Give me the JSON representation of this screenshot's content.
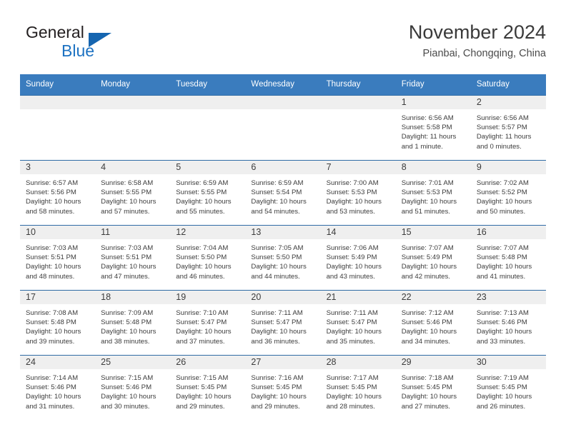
{
  "brand": {
    "name_top": "General",
    "name_bottom": "Blue",
    "triangle_color": "#1565b0",
    "blue_color": "#1d72c2"
  },
  "header": {
    "title": "November 2024",
    "subtitle": "Pianbai, Chongqing, China"
  },
  "theme": {
    "header_row_bg": "#3a7cbe",
    "daynum_band_bg": "#efefef",
    "row_border": "#2f6ba5",
    "text": "#3c3c3c"
  },
  "labels": {
    "sunrise_prefix": "Sunrise:",
    "sunset_prefix": "Sunset:",
    "daylight_prefix": "Daylight:"
  },
  "weekdays": [
    "Sunday",
    "Monday",
    "Tuesday",
    "Wednesday",
    "Thursday",
    "Friday",
    "Saturday"
  ],
  "weeks": [
    [
      {
        "day": "",
        "empty": true
      },
      {
        "day": "",
        "empty": true
      },
      {
        "day": "",
        "empty": true
      },
      {
        "day": "",
        "empty": true
      },
      {
        "day": "",
        "empty": true
      },
      {
        "day": "1",
        "sunrise": "Sunrise: 6:56 AM",
        "sunset": "Sunset: 5:58 PM",
        "daylight_line1": "Daylight: 11 hours",
        "daylight_line2": "and 1 minute."
      },
      {
        "day": "2",
        "sunrise": "Sunrise: 6:56 AM",
        "sunset": "Sunset: 5:57 PM",
        "daylight_line1": "Daylight: 11 hours",
        "daylight_line2": "and 0 minutes."
      }
    ],
    [
      {
        "day": "3",
        "sunrise": "Sunrise: 6:57 AM",
        "sunset": "Sunset: 5:56 PM",
        "daylight_line1": "Daylight: 10 hours",
        "daylight_line2": "and 58 minutes."
      },
      {
        "day": "4",
        "sunrise": "Sunrise: 6:58 AM",
        "sunset": "Sunset: 5:55 PM",
        "daylight_line1": "Daylight: 10 hours",
        "daylight_line2": "and 57 minutes."
      },
      {
        "day": "5",
        "sunrise": "Sunrise: 6:59 AM",
        "sunset": "Sunset: 5:55 PM",
        "daylight_line1": "Daylight: 10 hours",
        "daylight_line2": "and 55 minutes."
      },
      {
        "day": "6",
        "sunrise": "Sunrise: 6:59 AM",
        "sunset": "Sunset: 5:54 PM",
        "daylight_line1": "Daylight: 10 hours",
        "daylight_line2": "and 54 minutes."
      },
      {
        "day": "7",
        "sunrise": "Sunrise: 7:00 AM",
        "sunset": "Sunset: 5:53 PM",
        "daylight_line1": "Daylight: 10 hours",
        "daylight_line2": "and 53 minutes."
      },
      {
        "day": "8",
        "sunrise": "Sunrise: 7:01 AM",
        "sunset": "Sunset: 5:53 PM",
        "daylight_line1": "Daylight: 10 hours",
        "daylight_line2": "and 51 minutes."
      },
      {
        "day": "9",
        "sunrise": "Sunrise: 7:02 AM",
        "sunset": "Sunset: 5:52 PM",
        "daylight_line1": "Daylight: 10 hours",
        "daylight_line2": "and 50 minutes."
      }
    ],
    [
      {
        "day": "10",
        "sunrise": "Sunrise: 7:03 AM",
        "sunset": "Sunset: 5:51 PM",
        "daylight_line1": "Daylight: 10 hours",
        "daylight_line2": "and 48 minutes."
      },
      {
        "day": "11",
        "sunrise": "Sunrise: 7:03 AM",
        "sunset": "Sunset: 5:51 PM",
        "daylight_line1": "Daylight: 10 hours",
        "daylight_line2": "and 47 minutes."
      },
      {
        "day": "12",
        "sunrise": "Sunrise: 7:04 AM",
        "sunset": "Sunset: 5:50 PM",
        "daylight_line1": "Daylight: 10 hours",
        "daylight_line2": "and 46 minutes."
      },
      {
        "day": "13",
        "sunrise": "Sunrise: 7:05 AM",
        "sunset": "Sunset: 5:50 PM",
        "daylight_line1": "Daylight: 10 hours",
        "daylight_line2": "and 44 minutes."
      },
      {
        "day": "14",
        "sunrise": "Sunrise: 7:06 AM",
        "sunset": "Sunset: 5:49 PM",
        "daylight_line1": "Daylight: 10 hours",
        "daylight_line2": "and 43 minutes."
      },
      {
        "day": "15",
        "sunrise": "Sunrise: 7:07 AM",
        "sunset": "Sunset: 5:49 PM",
        "daylight_line1": "Daylight: 10 hours",
        "daylight_line2": "and 42 minutes."
      },
      {
        "day": "16",
        "sunrise": "Sunrise: 7:07 AM",
        "sunset": "Sunset: 5:48 PM",
        "daylight_line1": "Daylight: 10 hours",
        "daylight_line2": "and 41 minutes."
      }
    ],
    [
      {
        "day": "17",
        "sunrise": "Sunrise: 7:08 AM",
        "sunset": "Sunset: 5:48 PM",
        "daylight_line1": "Daylight: 10 hours",
        "daylight_line2": "and 39 minutes."
      },
      {
        "day": "18",
        "sunrise": "Sunrise: 7:09 AM",
        "sunset": "Sunset: 5:48 PM",
        "daylight_line1": "Daylight: 10 hours",
        "daylight_line2": "and 38 minutes."
      },
      {
        "day": "19",
        "sunrise": "Sunrise: 7:10 AM",
        "sunset": "Sunset: 5:47 PM",
        "daylight_line1": "Daylight: 10 hours",
        "daylight_line2": "and 37 minutes."
      },
      {
        "day": "20",
        "sunrise": "Sunrise: 7:11 AM",
        "sunset": "Sunset: 5:47 PM",
        "daylight_line1": "Daylight: 10 hours",
        "daylight_line2": "and 36 minutes."
      },
      {
        "day": "21",
        "sunrise": "Sunrise: 7:11 AM",
        "sunset": "Sunset: 5:47 PM",
        "daylight_line1": "Daylight: 10 hours",
        "daylight_line2": "and 35 minutes."
      },
      {
        "day": "22",
        "sunrise": "Sunrise: 7:12 AM",
        "sunset": "Sunset: 5:46 PM",
        "daylight_line1": "Daylight: 10 hours",
        "daylight_line2": "and 34 minutes."
      },
      {
        "day": "23",
        "sunrise": "Sunrise: 7:13 AM",
        "sunset": "Sunset: 5:46 PM",
        "daylight_line1": "Daylight: 10 hours",
        "daylight_line2": "and 33 minutes."
      }
    ],
    [
      {
        "day": "24",
        "sunrise": "Sunrise: 7:14 AM",
        "sunset": "Sunset: 5:46 PM",
        "daylight_line1": "Daylight: 10 hours",
        "daylight_line2": "and 31 minutes."
      },
      {
        "day": "25",
        "sunrise": "Sunrise: 7:15 AM",
        "sunset": "Sunset: 5:46 PM",
        "daylight_line1": "Daylight: 10 hours",
        "daylight_line2": "and 30 minutes."
      },
      {
        "day": "26",
        "sunrise": "Sunrise: 7:15 AM",
        "sunset": "Sunset: 5:45 PM",
        "daylight_line1": "Daylight: 10 hours",
        "daylight_line2": "and 29 minutes."
      },
      {
        "day": "27",
        "sunrise": "Sunrise: 7:16 AM",
        "sunset": "Sunset: 5:45 PM",
        "daylight_line1": "Daylight: 10 hours",
        "daylight_line2": "and 29 minutes."
      },
      {
        "day": "28",
        "sunrise": "Sunrise: 7:17 AM",
        "sunset": "Sunset: 5:45 PM",
        "daylight_line1": "Daylight: 10 hours",
        "daylight_line2": "and 28 minutes."
      },
      {
        "day": "29",
        "sunrise": "Sunrise: 7:18 AM",
        "sunset": "Sunset: 5:45 PM",
        "daylight_line1": "Daylight: 10 hours",
        "daylight_line2": "and 27 minutes."
      },
      {
        "day": "30",
        "sunrise": "Sunrise: 7:19 AM",
        "sunset": "Sunset: 5:45 PM",
        "daylight_line1": "Daylight: 10 hours",
        "daylight_line2": "and 26 minutes."
      }
    ]
  ]
}
